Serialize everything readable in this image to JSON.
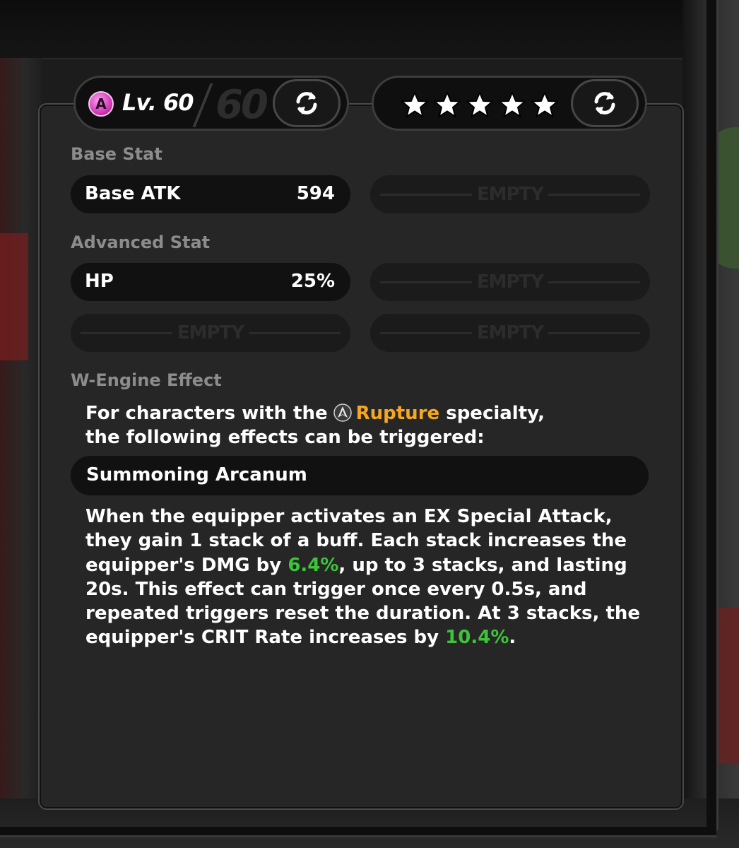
{
  "header": {
    "rank": "A",
    "level_label": "Lv. 60",
    "max_level": "60",
    "star_count": 5,
    "star_color": "#ffffff"
  },
  "base_stat": {
    "label": "Base Stat",
    "name": "Base ATK",
    "value": "594",
    "empty_label": "EMPTY"
  },
  "advanced_stat": {
    "label": "Advanced Stat",
    "name": "HP",
    "value": "25%",
    "empty_label": "EMPTY"
  },
  "effect": {
    "label": "W-Engine Effect",
    "intro_before": "For characters with the",
    "specialty": "Rupture",
    "intro_after": "specialty,",
    "intro_line2": "the following effects can be triggered:",
    "name": "Summoning Arcanum",
    "desc_part1": "When the equipper activates an EX Special Attack, they gain 1 stack of a buff. Each stack increases the equipper's DMG by",
    "dmg_value": "6.4%",
    "desc_part2": ", up to 3 stacks, and lasting 20s. This effect can trigger once every 0.5s, and repeated triggers reset the duration. At 3 stacks, the equipper's CRIT Rate increases by",
    "crit_value": "10.4%",
    "desc_part3": ".",
    "highlight_color": "#3dc43a",
    "specialty_color": "#f5a623"
  }
}
